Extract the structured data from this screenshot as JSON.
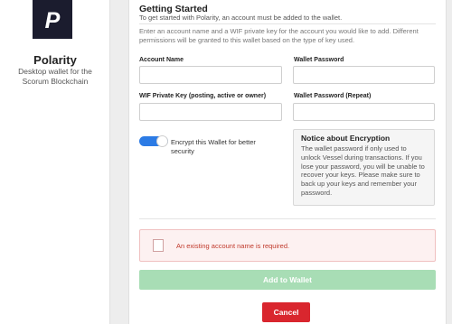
{
  "app": {
    "name": "Polarity",
    "description": "Desktop wallet for the Scorum Blockchain",
    "logo_letter": "P"
  },
  "page": {
    "title": "Getting Started",
    "subtitle": "To get started with Polarity, an account must be added to the wallet.",
    "description": "Enter an account name and a WIF private key for the account you would like to add. Different permissions will be granted to this wallet based on the type of key used."
  },
  "form": {
    "account_name": {
      "label": "Account Name",
      "value": "",
      "placeholder": ""
    },
    "wif_key": {
      "label": "WIF Private Key (posting, active or owner)",
      "value": "",
      "placeholder": ""
    },
    "wallet_password": {
      "label": "Wallet Password",
      "value": "",
      "placeholder": ""
    },
    "wallet_password_repeat": {
      "label": "Wallet Password (Repeat)",
      "value": "",
      "placeholder": ""
    },
    "encrypt_toggle": {
      "label": "Encrypt this Wallet for better security",
      "checked": true
    }
  },
  "notice": {
    "title": "Notice about Encryption",
    "body": "The wallet password if only used to unlock Vessel during transactions. If you lose your password, you will be unable to recover your keys. Please make sure to back up your keys and remember your password."
  },
  "error": {
    "message": "An existing account name is required."
  },
  "buttons": {
    "add_label": "Add to Wallet",
    "cancel_label": "Cancel"
  },
  "colors": {
    "accent": "#2c7be5",
    "success_disabled": "#a8ddb5",
    "danger": "#d9262e",
    "logo_bg": "#1b1c2e"
  }
}
